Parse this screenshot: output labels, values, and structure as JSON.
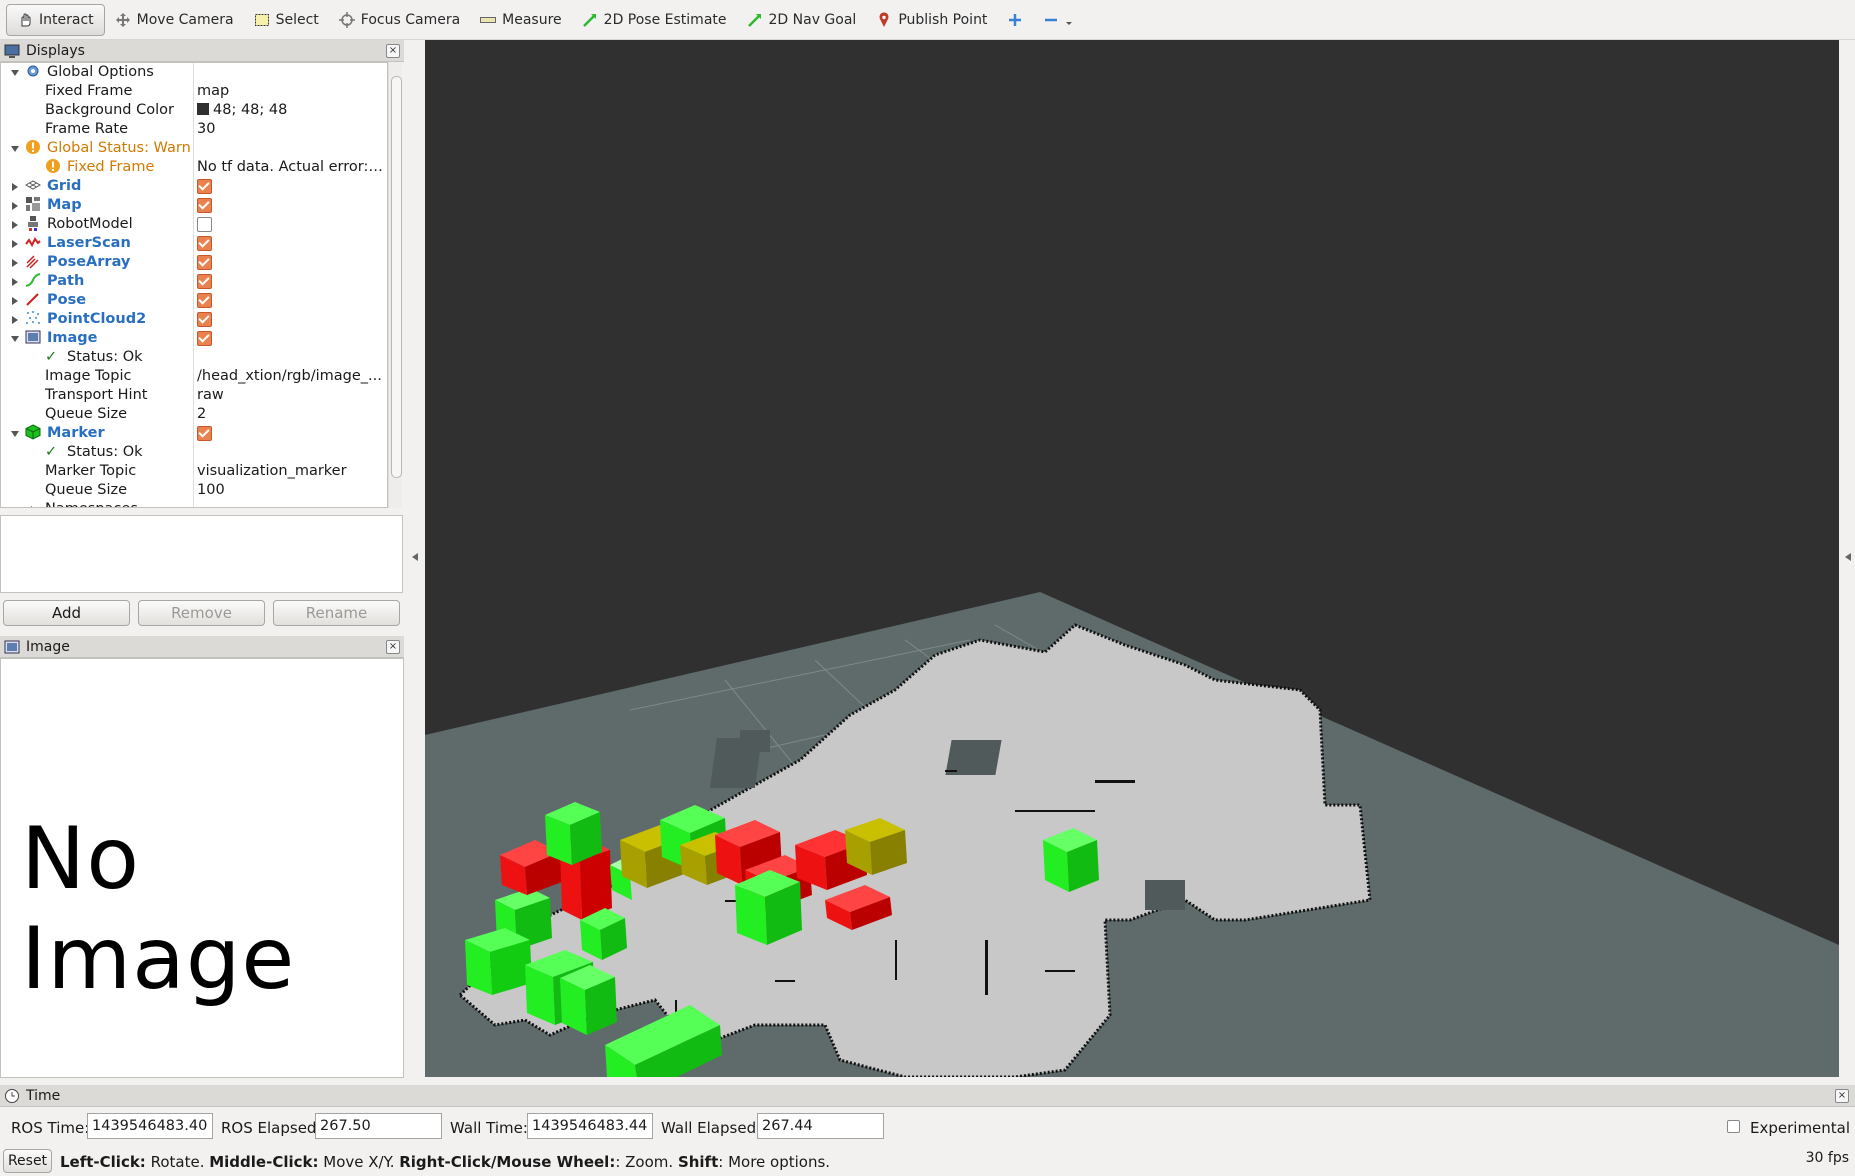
{
  "toolbar": {
    "tools": [
      {
        "label": "Interact",
        "icon": "hand-icon"
      },
      {
        "label": "Move Camera",
        "icon": "move-camera-icon"
      },
      {
        "label": "Select",
        "icon": "select-box-icon"
      },
      {
        "label": "Focus Camera",
        "icon": "focus-camera-icon"
      },
      {
        "label": "Measure",
        "icon": "ruler-icon"
      },
      {
        "label": "2D Pose Estimate",
        "icon": "green-arrow-icon"
      },
      {
        "label": "2D Nav Goal",
        "icon": "green-arrow-icon"
      },
      {
        "label": "Publish Point",
        "icon": "map-pin-icon"
      }
    ]
  },
  "displays": {
    "title": "Displays",
    "global_options": {
      "label": "Global Options",
      "fixed_frame_label": "Fixed Frame",
      "fixed_frame_value": "map",
      "bg_color_label": "Background Color",
      "bg_color_value": "48; 48; 48",
      "bg_color_swatch": "#303030",
      "frame_rate_label": "Frame Rate",
      "frame_rate_value": "30"
    },
    "global_status": {
      "label": "Global Status: Warn",
      "fixed_frame_label": "Fixed Frame",
      "fixed_frame_value": "No tf data.  Actual error: F..."
    },
    "items": [
      {
        "label": "Grid",
        "checked": true
      },
      {
        "label": "Map",
        "checked": true
      },
      {
        "label": "RobotModel",
        "checked": false
      },
      {
        "label": "LaserScan",
        "checked": true
      },
      {
        "label": "PoseArray",
        "checked": true
      },
      {
        "label": "Path",
        "checked": true
      },
      {
        "label": "Pose",
        "checked": true
      },
      {
        "label": "PointCloud2",
        "checked": true
      }
    ],
    "image": {
      "label": "Image",
      "status": "Status: Ok",
      "topic_label": "Image Topic",
      "topic_value": "/head_xtion/rgb/image_...",
      "transport_label": "Transport Hint",
      "transport_value": "raw",
      "queue_label": "Queue Size",
      "queue_value": "2"
    },
    "marker": {
      "label": "Marker",
      "status": "Status: Ok",
      "topic_label": "Marker Topic",
      "topic_value": "visualization_marker",
      "queue_label": "Queue Size",
      "queue_value": "100",
      "namespaces_label": "Namespaces"
    },
    "buttons": {
      "add": "Add",
      "remove": "Remove",
      "rename": "Rename"
    }
  },
  "image_panel": {
    "title": "Image",
    "placeholder": "No Image"
  },
  "time": {
    "title": "Time",
    "ros_time_label": "ROS Time:",
    "ros_time_value": "1439546483.40",
    "ros_elapsed_label": "ROS Elapsed:",
    "ros_elapsed_value": "267.50",
    "wall_time_label": "Wall Time:",
    "wall_time_value": "1439546483.44",
    "wall_elapsed_label": "Wall Elapsed:",
    "wall_elapsed_value": "267.44",
    "experimental_label": "Experimental"
  },
  "status": {
    "reset": "Reset",
    "left_click": "Left-Click:",
    "left_click_desc": " Rotate. ",
    "middle_click": "Middle-Click:",
    "middle_click_desc": " Move X/Y. ",
    "right_click": "Right-Click/Mouse Wheel:",
    "right_click_desc": ": Zoom. ",
    "shift": "Shift",
    "shift_desc": ": More options.",
    "fps": "30 fps"
  },
  "colors": {
    "view_background": "#303030",
    "ground": "#5f6b6b",
    "map_free": "#c9c9c9",
    "marker_green": "#22ee22",
    "marker_red": "#ee1111",
    "marker_olive": "#a8a000",
    "accent_blue": "#2a6fbf",
    "warn_orange": "#d07a00"
  }
}
